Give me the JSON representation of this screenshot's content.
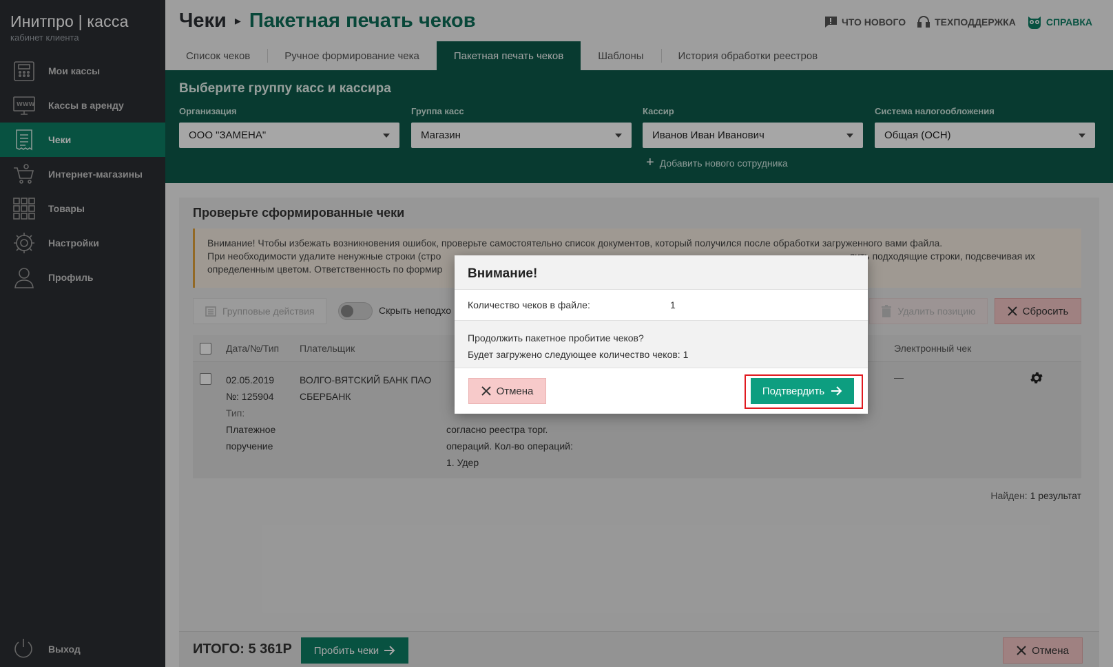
{
  "brand": {
    "name": "Инитпро | касса",
    "subtitle": "кабинет клиента"
  },
  "sidebar": {
    "items": [
      {
        "label": "Мои кассы",
        "icon": "cash-register-icon"
      },
      {
        "label": "Кассы в аренду",
        "icon": "www-monitor-icon"
      },
      {
        "label": "Чеки",
        "icon": "receipt-icon",
        "active": true
      },
      {
        "label": "Интернет-магазины",
        "icon": "cart-at-icon"
      },
      {
        "label": "Товары",
        "icon": "grid-icon"
      },
      {
        "label": "Настройки",
        "icon": "gear-icon"
      },
      {
        "label": "Профиль",
        "icon": "user-icon"
      }
    ],
    "logout": "Выход"
  },
  "header": {
    "section": "Чеки",
    "title": "Пакетная печать чеков",
    "links": {
      "whats_new": "ЧТО НОВОГО",
      "support": "ТЕХПОДДЕРЖКА",
      "help": "СПРАВКА"
    }
  },
  "tabs": [
    {
      "label": "Список чеков"
    },
    {
      "label": "Ручное формирование чека"
    },
    {
      "label": "Пакетная печать чеков",
      "active": true
    },
    {
      "label": "Шаблоны"
    },
    {
      "label": "История обработки реестров"
    }
  ],
  "panel": {
    "title": "Выберите группу касс и кассира",
    "fields": {
      "org": {
        "label": "Организация",
        "value": "ООО \"ЗАМЕНА\""
      },
      "group": {
        "label": "Группа касс",
        "value": "Магазин"
      },
      "cashier": {
        "label": "Кассир",
        "value": "Иванов Иван Иванович"
      },
      "tax": {
        "label": "Система налогообложения",
        "value": "Общая (ОСН)"
      }
    },
    "add_employee": "Добавить нового сотрудника"
  },
  "content": {
    "title": "Проверьте сформированные чеки",
    "warning": {
      "line1": "Внимание! Чтобы избежать возникновения ошибок, проверьте самостоятельно список документов, который получился после обработки загруженного вами файла.",
      "line2a": "При необходимости удалите ненужные строки (стро",
      "line2b": "лить подходящие строки, подсвечивая их",
      "line3": "определенным цветом. Ответственность по формир"
    },
    "toolbar": {
      "group_actions": "Групповые действия",
      "hide_label": "Скрыть неподхо",
      "delete_position": "Удалить позицию",
      "reset": "Сбросить"
    },
    "table": {
      "headers": {
        "date": "Дата/№/Тип",
        "payer": "Плательщик",
        "e_receipt": "Электронный чек"
      },
      "row": {
        "date": "02.05.2019",
        "number": "№: 125904",
        "type_label": "Тип:",
        "type_line1": "Платежное",
        "type_line2": "поручение",
        "payer_line1": "ВОЛГО-ВЯТСКИЙ БАНК ПАО",
        "payer_line2": "СБЕРБАНК",
        "desc_line1": "согласно реестра торг.",
        "desc_line2": "операций. Кол-во операций:",
        "desc_line3": "1. Удер",
        "e_receipt": "—"
      }
    },
    "found_label": "Найден:",
    "found_value": "1 результат"
  },
  "footer": {
    "total": "ИТОГО: 5 361Р",
    "print_button": "Пробить чеки",
    "cancel_button": "Отмена"
  },
  "modal": {
    "title": "Внимание!",
    "count_label": "Количество чеков в файле:",
    "count_value": "1",
    "question": "Продолжить пакетное пробитие чеков?",
    "info": "Будет загружено следующее количество чеков: 1",
    "cancel": "Отмена",
    "confirm": "Подтвердить"
  },
  "colors": {
    "accent": "#0d7e65",
    "panel": "#0d5a4a",
    "sidebar": "#2b2e33",
    "highlight": "#e0191f"
  }
}
